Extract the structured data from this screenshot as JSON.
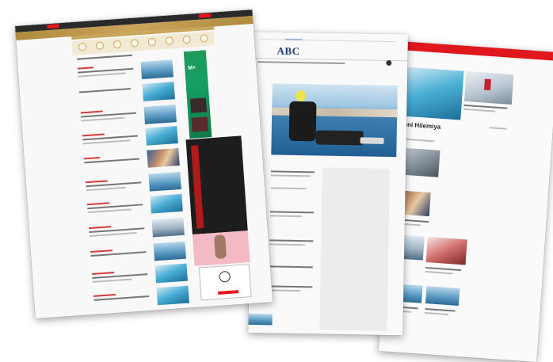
{
  "pages": {
    "right": {
      "name": "news-site-mockup-right",
      "brand_color": "#e1171e",
      "headline": "dmeni Hilemiya",
      "headline_2": "s"
    },
    "middle": {
      "name": "news-site-mockup-middle",
      "logo": "ABC",
      "brand_color": "#1b3d7a"
    },
    "left": {
      "name": "news-site-mockup-left",
      "accent_color": "#c9a55a",
      "ad_color": "#1f9a5a",
      "ad_text": "M+"
    }
  },
  "icons": [
    "search-icon"
  ]
}
